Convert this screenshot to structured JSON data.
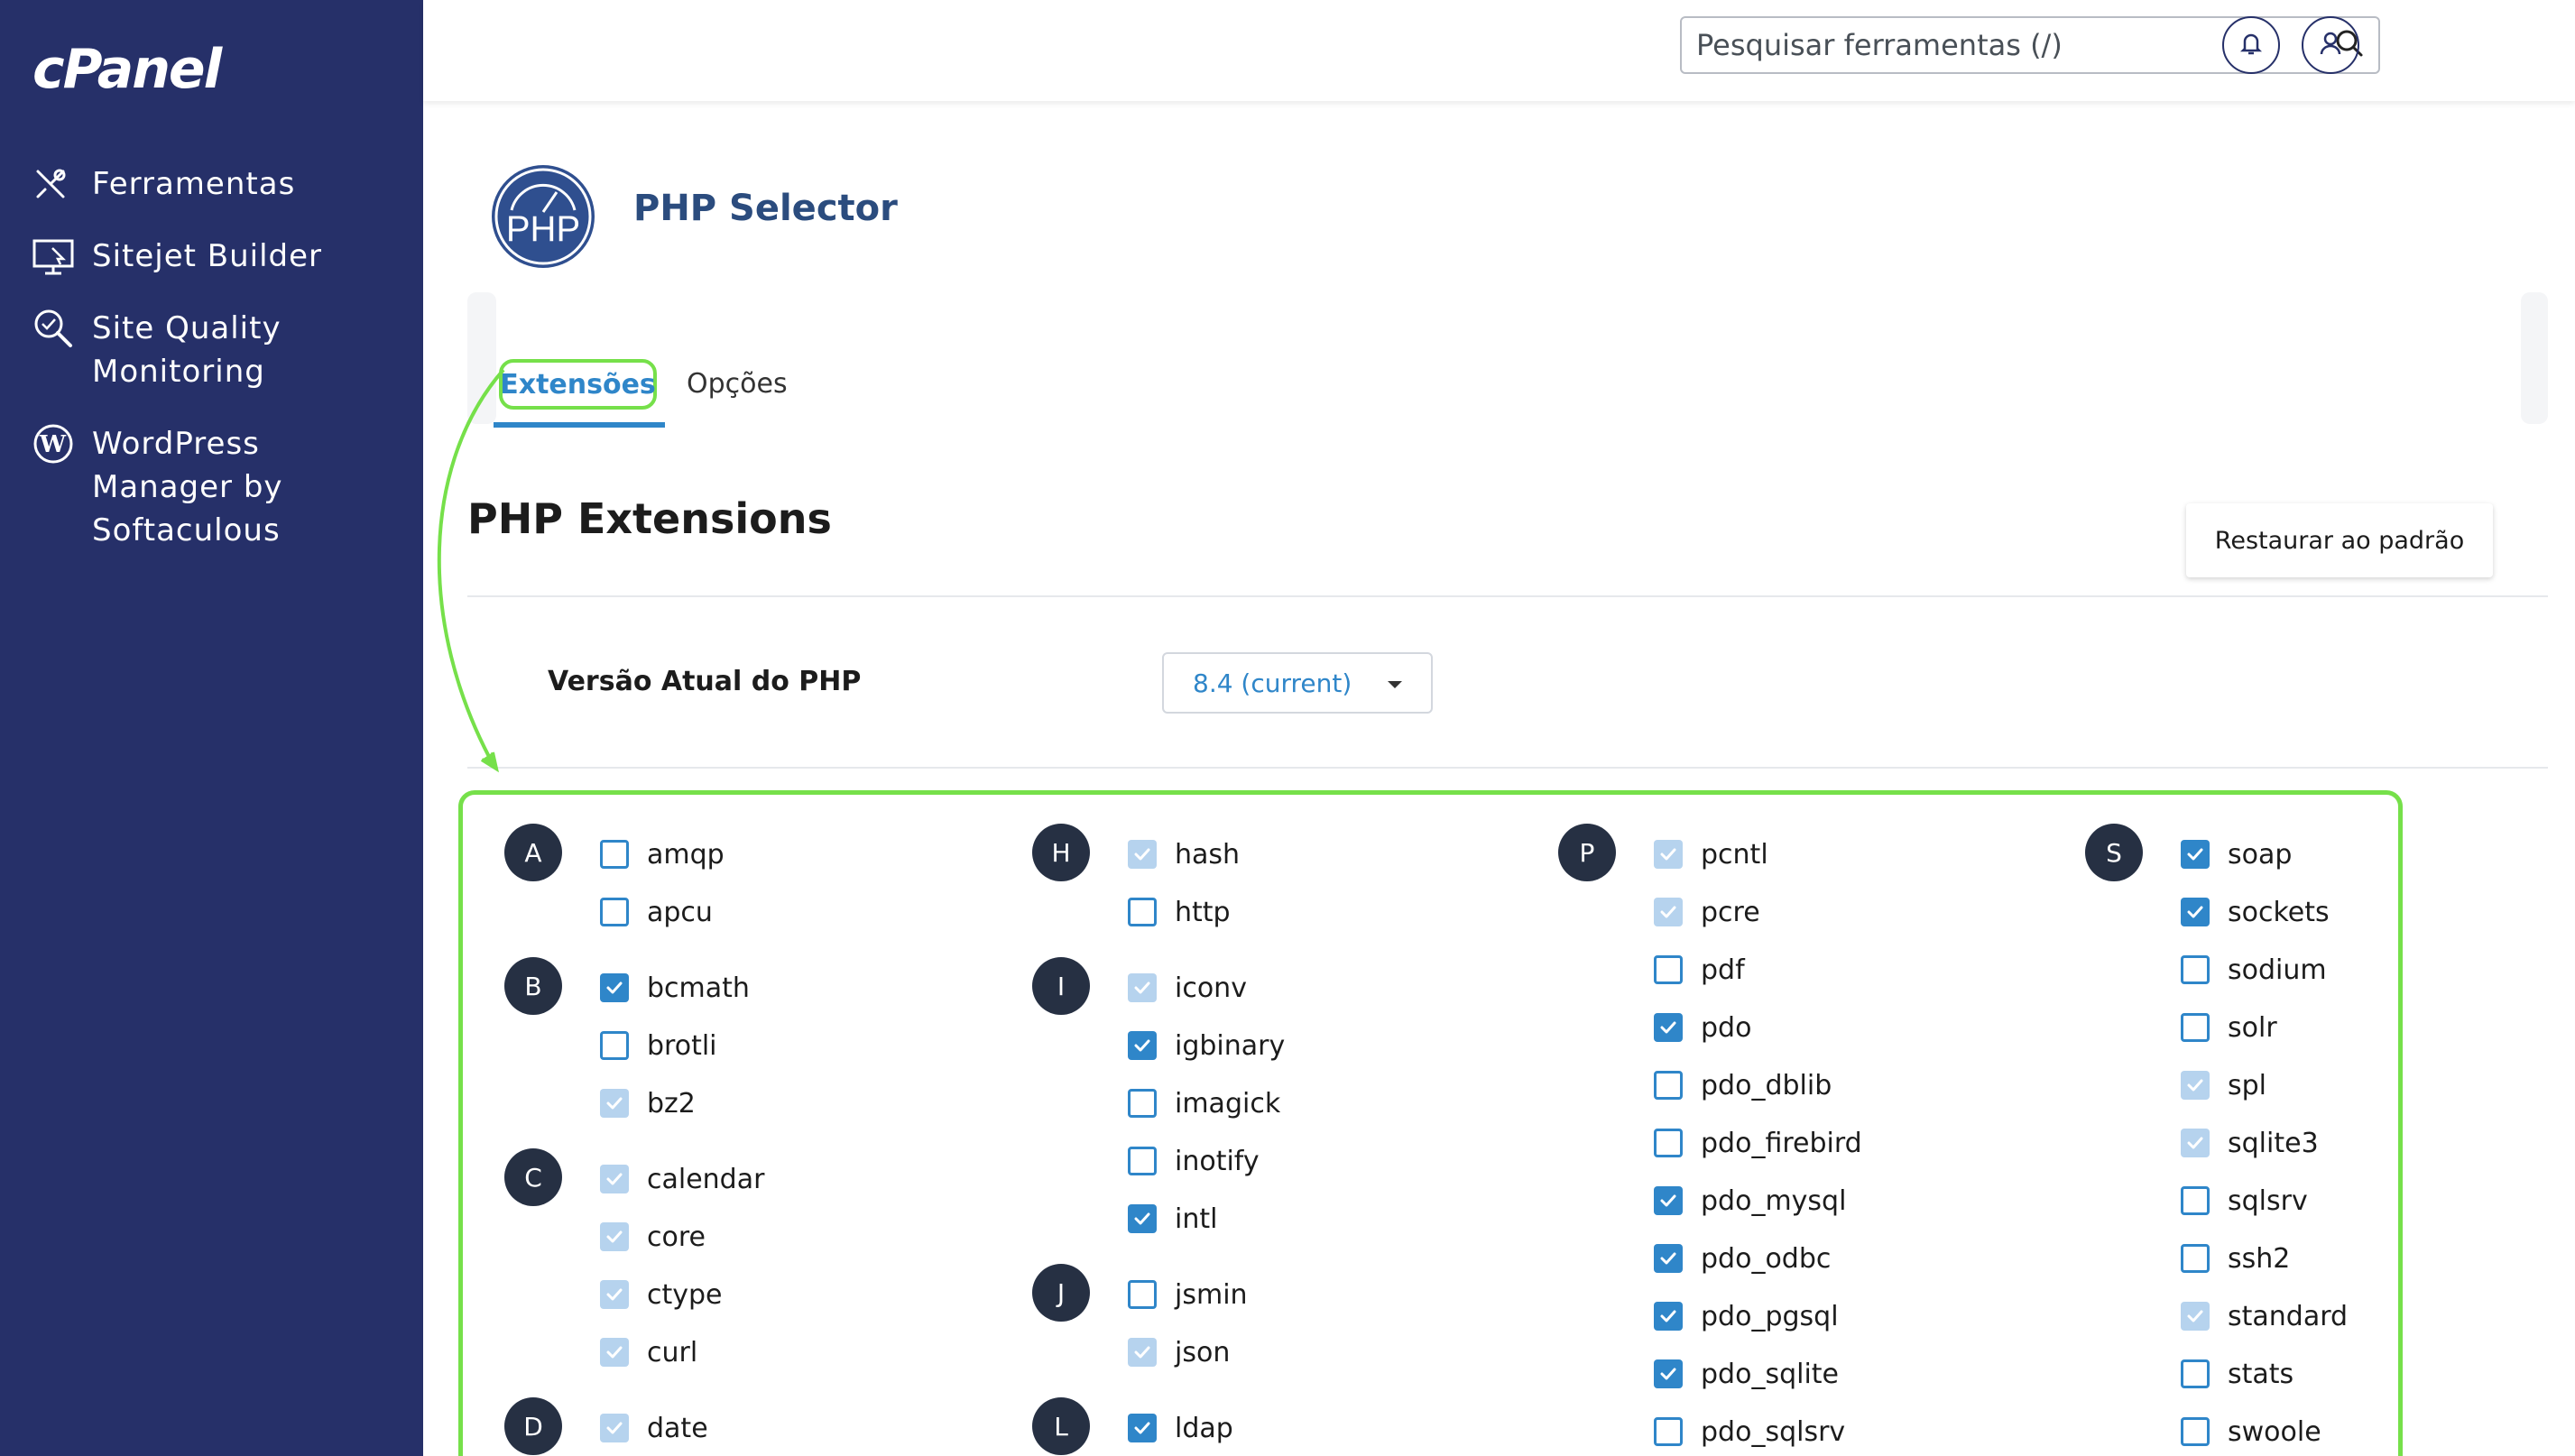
{
  "sidebar": {
    "logo": "cPanel",
    "items": [
      {
        "label": "Ferramentas",
        "icon": "tools-icon"
      },
      {
        "label": "Sitejet Builder",
        "icon": "monitor-icon"
      },
      {
        "label": "Site Quality\nMonitoring",
        "icon": "magnifier-icon"
      },
      {
        "label": "WordPress\nManager by\nSoftaculous",
        "icon": "wordpress-icon"
      }
    ]
  },
  "header": {
    "search_placeholder": "Pesquisar ferramentas (/)"
  },
  "page": {
    "logo_text": "PHP",
    "title": "PHP Selector",
    "tabs": [
      {
        "label": "Extensões",
        "active": true
      },
      {
        "label": "Opções",
        "active": false
      }
    ],
    "section_title": "PHP Extensions",
    "restore_button": "Restaurar ao padrão",
    "version_label": "Versão Atual do PHP",
    "version_value": "8.4 (current)"
  },
  "colors": {
    "sidebar_bg": "#263069",
    "accent": "#2f86c9",
    "highlight": "#76e04a",
    "letter_badge": "#263043"
  },
  "extensions": {
    "columns": [
      {
        "groups": [
          {
            "letter": "A",
            "items": [
              {
                "name": "amqp",
                "state": "unchecked"
              },
              {
                "name": "apcu",
                "state": "unchecked"
              }
            ]
          },
          {
            "letter": "B",
            "items": [
              {
                "name": "bcmath",
                "state": "checked"
              },
              {
                "name": "brotli",
                "state": "unchecked"
              },
              {
                "name": "bz2",
                "state": "disabled"
              }
            ]
          },
          {
            "letter": "C",
            "items": [
              {
                "name": "calendar",
                "state": "disabled"
              },
              {
                "name": "core",
                "state": "disabled"
              },
              {
                "name": "ctype",
                "state": "disabled"
              },
              {
                "name": "curl",
                "state": "disabled"
              }
            ]
          },
          {
            "letter": "D",
            "items": [
              {
                "name": "date",
                "state": "disabled"
              }
            ]
          }
        ]
      },
      {
        "groups": [
          {
            "letter": "H",
            "items": [
              {
                "name": "hash",
                "state": "disabled"
              },
              {
                "name": "http",
                "state": "unchecked"
              }
            ]
          },
          {
            "letter": "I",
            "items": [
              {
                "name": "iconv",
                "state": "disabled"
              },
              {
                "name": "igbinary",
                "state": "checked"
              },
              {
                "name": "imagick",
                "state": "unchecked"
              },
              {
                "name": "inotify",
                "state": "unchecked"
              },
              {
                "name": "intl",
                "state": "checked"
              }
            ]
          },
          {
            "letter": "J",
            "items": [
              {
                "name": "jsmin",
                "state": "unchecked"
              },
              {
                "name": "json",
                "state": "disabled"
              }
            ]
          },
          {
            "letter": "L",
            "items": [
              {
                "name": "ldap",
                "state": "checked"
              }
            ]
          }
        ]
      },
      {
        "groups": [
          {
            "letter": "P",
            "items": [
              {
                "name": "pcntl",
                "state": "disabled"
              },
              {
                "name": "pcre",
                "state": "disabled"
              },
              {
                "name": "pdf",
                "state": "unchecked"
              },
              {
                "name": "pdo",
                "state": "checked"
              },
              {
                "name": "pdo_dblib",
                "state": "unchecked"
              },
              {
                "name": "pdo_firebird",
                "state": "unchecked"
              },
              {
                "name": "pdo_mysql",
                "state": "checked"
              },
              {
                "name": "pdo_odbc",
                "state": "checked"
              },
              {
                "name": "pdo_pgsql",
                "state": "checked"
              },
              {
                "name": "pdo_sqlite",
                "state": "checked"
              },
              {
                "name": "pdo_sqlsrv",
                "state": "unchecked"
              }
            ]
          }
        ]
      },
      {
        "groups": [
          {
            "letter": "S",
            "items": [
              {
                "name": "soap",
                "state": "checked"
              },
              {
                "name": "sockets",
                "state": "checked"
              },
              {
                "name": "sodium",
                "state": "unchecked"
              },
              {
                "name": "solr",
                "state": "unchecked"
              },
              {
                "name": "spl",
                "state": "disabled"
              },
              {
                "name": "sqlite3",
                "state": "disabled"
              },
              {
                "name": "sqlsrv",
                "state": "unchecked"
              },
              {
                "name": "ssh2",
                "state": "unchecked"
              },
              {
                "name": "standard",
                "state": "disabled"
              },
              {
                "name": "stats",
                "state": "unchecked"
              },
              {
                "name": "swoole",
                "state": "unchecked"
              }
            ]
          }
        ]
      }
    ]
  }
}
